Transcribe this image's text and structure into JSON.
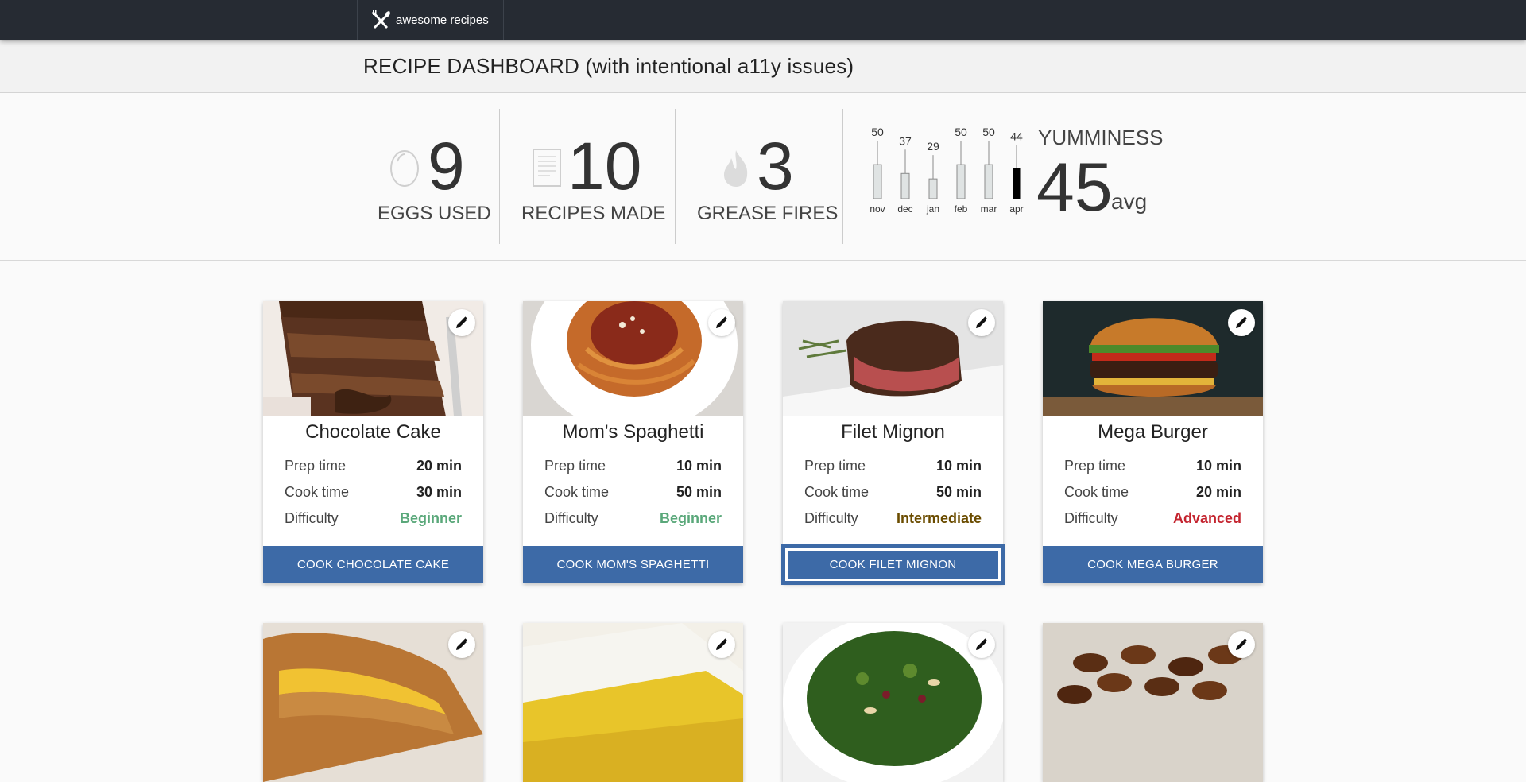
{
  "brand": {
    "name": "awesome recipes",
    "logo_icon": "utensils-icon"
  },
  "page_title": "RECIPE DASHBOARD (with intentional a11y issues)",
  "stats": [
    {
      "icon": "egg-icon",
      "value": "9",
      "label": "EGGS USED"
    },
    {
      "icon": "document-icon",
      "value": "10",
      "label": "RECIPES MADE"
    },
    {
      "icon": "flame-icon",
      "value": "3",
      "label": "GREASE FIRES"
    }
  ],
  "yumminess": {
    "label": "YUMMINESS",
    "value": "45",
    "unit": "avg"
  },
  "chart_data": {
    "type": "bar",
    "categories": [
      "nov",
      "dec",
      "jan",
      "feb",
      "mar",
      "apr"
    ],
    "values": [
      50,
      37,
      29,
      50,
      50,
      44
    ],
    "data_labels": [
      "50",
      "37",
      "29",
      "50",
      "50",
      "44"
    ],
    "highlight_index": 5,
    "colors": {
      "bar": "#dfe3e3",
      "highlight": "#000000",
      "stroke": "#8b8b8b"
    }
  },
  "recipes": [
    {
      "name": "Chocolate Cake",
      "image": "chocolate-cake-photo",
      "prep_label": "Prep time",
      "prep": "20 min",
      "cook_label": "Cook time",
      "cook": "30 min",
      "difficulty_label": "Difficulty",
      "difficulty": "Beginner",
      "button": "COOK CHOCOLATE CAKE"
    },
    {
      "name": "Mom's Spaghetti",
      "image": "spaghetti-photo",
      "prep_label": "Prep time",
      "prep": "10 min",
      "cook_label": "Cook time",
      "cook": "50 min",
      "difficulty_label": "Difficulty",
      "difficulty": "Beginner",
      "button": "COOK MOM'S SPAGHETTI"
    },
    {
      "name": "Filet Mignon",
      "image": "filet-mignon-photo",
      "prep_label": "Prep time",
      "prep": "10 min",
      "cook_label": "Cook time",
      "cook": "50 min",
      "difficulty_label": "Difficulty",
      "difficulty": "Intermediate",
      "button": "COOK FILET MIGNON"
    },
    {
      "name": "Mega Burger",
      "image": "burger-photo",
      "prep_label": "Prep time",
      "prep": "10 min",
      "cook_label": "Cook time",
      "cook": "20 min",
      "difficulty_label": "Difficulty",
      "difficulty": "Advanced",
      "button": "COOK MEGA BURGER"
    }
  ],
  "recipes_row2_images": [
    "grilled-cheese-photo",
    "lemon-bars-photo",
    "kale-salad-photo",
    "candied-pecans-photo"
  ],
  "edit_icon": "pencil-icon"
}
